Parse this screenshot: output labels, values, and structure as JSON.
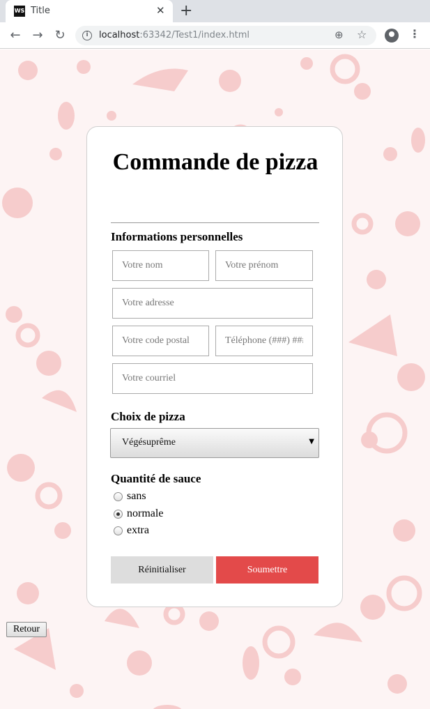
{
  "browser": {
    "tab_title": "Title",
    "favicon_text": "WS",
    "url_host": "localhost",
    "url_rest": ":63342/Test1/index.html",
    "icons": [
      "back-arrow-icon",
      "forward-arrow-icon",
      "reload-icon",
      "info-icon",
      "zoom-icon",
      "star-icon",
      "account-icon",
      "menu-icon"
    ]
  },
  "form": {
    "title": "Commande de pizza",
    "personal_section": "Informations personnelles",
    "fields": {
      "nom": "Votre nom",
      "prenom": "Votre prénom",
      "adresse": "Votre adresse",
      "code_postal": "Votre code postal",
      "telephone": "Téléphone (###) ###-####",
      "courriel": "Votre courriel"
    },
    "pizza_section": "Choix de pizza",
    "pizza_selected": "Végésuprême",
    "sauce_section": "Quantité de sauce",
    "sauce_options": [
      "sans",
      "normale",
      "extra"
    ],
    "sauce_selected": "normale",
    "reset_label": "Réinitialiser",
    "submit_label": "Soumettre"
  },
  "back_label": "Retour",
  "colors": {
    "accent": "#e34a4a",
    "pattern": "#f6cccc",
    "background": "#fdf4f4"
  }
}
